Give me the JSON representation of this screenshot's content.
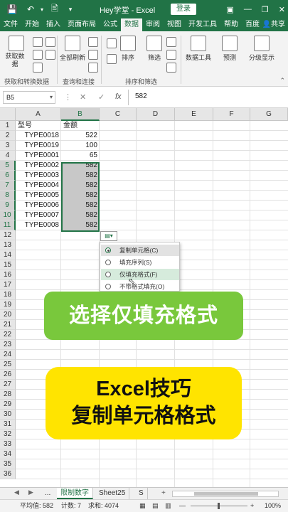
{
  "titlebar": {
    "title": "Hey学堂 - Excel",
    "login_label": "登录",
    "save_icon": "save-icon",
    "undo_icon": "undo-icon"
  },
  "tabs": [
    "文件",
    "开始",
    "插入",
    "页面布局",
    "公式",
    "数据",
    "审阅",
    "视图",
    "开发工具",
    "帮助",
    "百度网盘"
  ],
  "active_tab": "数据",
  "share_label": "共享",
  "ribbon": {
    "get_data": "获取数据",
    "refresh_all": "全部刷新",
    "sort": "排序",
    "filter": "筛选",
    "data_tools": "数据工具",
    "forecast": "预测",
    "outline": "分级显示",
    "group_get": "获取和转换数据",
    "group_query": "查询和连接",
    "group_sort": "排序和筛选"
  },
  "formula_bar": {
    "name_box": "B5",
    "cancel": "✕",
    "confirm": "✓",
    "fx": "fx",
    "value": "582"
  },
  "columns": [
    "A",
    "B",
    "C",
    "D",
    "E",
    "F",
    "G"
  ],
  "rows": [
    "1",
    "2",
    "3",
    "4",
    "5",
    "6",
    "7",
    "8",
    "9",
    "10",
    "11",
    "12",
    "13",
    "14",
    "15",
    "16",
    "17",
    "18",
    "19",
    "20",
    "21",
    "22",
    "23",
    "24",
    "25",
    "26",
    "27",
    "28",
    "29",
    "30",
    "31",
    "32",
    "33",
    "34",
    "35",
    "36"
  ],
  "cells": {
    "header_a": "型号",
    "header_b": "金额",
    "data": [
      {
        "type": "TYPE0018",
        "amount": "522"
      },
      {
        "type": "TYPE0019",
        "amount": "100"
      },
      {
        "type": "TYPE0001",
        "amount": "65"
      },
      {
        "type": "TYPE0002",
        "amount": "582"
      },
      {
        "type": "TYPE0003",
        "amount": "582"
      },
      {
        "type": "TYPE0004",
        "amount": "582"
      },
      {
        "type": "TYPE0005",
        "amount": "582"
      },
      {
        "type": "TYPE0006",
        "amount": "582"
      },
      {
        "type": "TYPE0007",
        "amount": "582"
      },
      {
        "type": "TYPE0008",
        "amount": "582"
      }
    ]
  },
  "autofill_menu": {
    "items": [
      "复制单元格(C)",
      "填充序列(S)",
      "仅填充格式(F)",
      "不带格式填充(O)"
    ],
    "selected_index": 0,
    "hover_index": 2
  },
  "overlay": {
    "green_text": "选择仅填充格式",
    "yellow_line1": "Excel技巧",
    "yellow_line2": "复制单元格格式"
  },
  "sheets": {
    "ellipsis": "...",
    "tabs": [
      "限制数字",
      "Sheet25",
      "S"
    ],
    "active": "限制数字",
    "add": "+"
  },
  "status": {
    "average": "平均值: 582",
    "count": "计数: 7",
    "sum": "求和: 4074",
    "zoom": "100%"
  }
}
